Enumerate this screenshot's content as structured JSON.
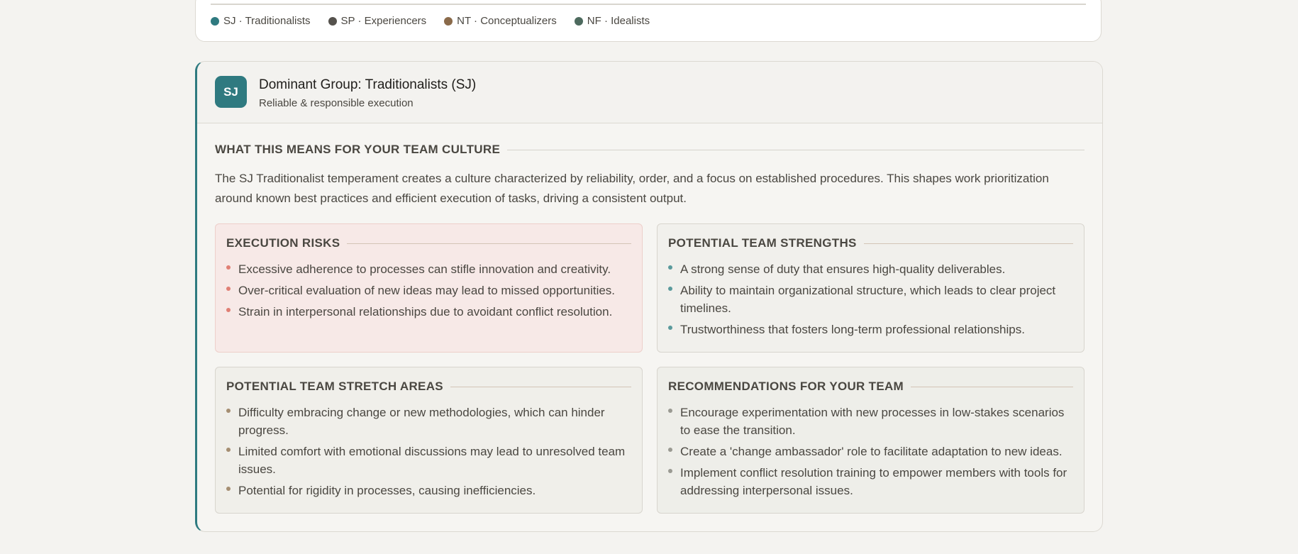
{
  "legend": [
    {
      "label": "SJ · Traditionalists",
      "color": "#2f7a80"
    },
    {
      "label": "SP · Experiencers",
      "color": "#55524d"
    },
    {
      "label": "NT · Conceptualizers",
      "color": "#8a6a4a"
    },
    {
      "label": "NF · Idealists",
      "color": "#4d6a5e"
    }
  ],
  "group": {
    "badge": "SJ",
    "title": "Dominant Group: Traditionalists (SJ)",
    "subtitle": "Reliable & responsible execution",
    "accent_color": "#2f7a80"
  },
  "culture": {
    "heading": "WHAT THIS MEANS FOR YOUR TEAM CULTURE",
    "text": "The SJ Traditionalist temperament creates a culture characterized by reliability, order, and a focus on established procedures. This shapes work prioritization around known best practices and efficient execution of tasks, driving a consistent output."
  },
  "risks": {
    "heading": "EXECUTION RISKS",
    "bullet_color": "#e07f74",
    "items": [
      "Excessive adherence to processes can stifle innovation and creativity.",
      "Over-critical evaluation of new ideas may lead to missed opportunities.",
      "Strain in interpersonal relationships due to avoidant conflict resolution."
    ]
  },
  "strengths": {
    "heading": "POTENTIAL TEAM STRENGTHS",
    "bullet_color": "#5a9a9c",
    "items": [
      "A strong sense of duty that ensures high-quality deliverables.",
      "Ability to maintain organizational structure, which leads to clear project timelines.",
      "Trustworthiness that fosters long-term professional relationships."
    ]
  },
  "stretch": {
    "heading": "POTENTIAL TEAM STRETCH AREAS",
    "bullet_color": "#a58e72",
    "items": [
      "Difficulty embracing change or new methodologies, which can hinder progress.",
      "Limited comfort with emotional discussions may lead to unresolved team issues.",
      "Potential for rigidity in processes, causing inefficiencies."
    ]
  },
  "recommendations": {
    "heading": "RECOMMENDATIONS FOR YOUR TEAM",
    "bullet_color": "#9a9a92",
    "items": [
      "Encourage experimentation with new processes in low-stakes scenarios to ease the transition.",
      "Create a 'change ambassador' role to facilitate adaptation to new ideas.",
      "Implement conflict resolution training to empower members with tools for addressing interpersonal issues."
    ]
  }
}
